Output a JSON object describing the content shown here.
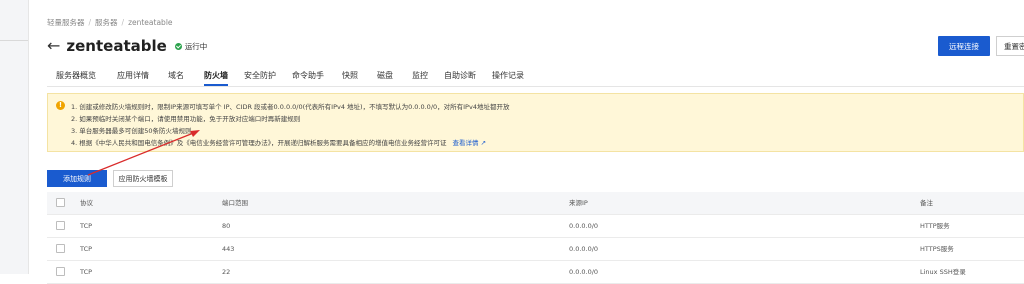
{
  "breadcrumb": {
    "items": [
      "轻量服务器",
      "服务器",
      "zenteatable"
    ]
  },
  "header": {
    "title": "zenteatable",
    "status": "运行中",
    "remote_button": "远程连接",
    "reset_button": "重置密码"
  },
  "tabs": [
    {
      "label": "服务器概览"
    },
    {
      "label": "应用详情"
    },
    {
      "label": "域名"
    },
    {
      "label": "防火墙"
    },
    {
      "label": "安全防护"
    },
    {
      "label": "命令助手"
    },
    {
      "label": "快照"
    },
    {
      "label": "磁盘"
    },
    {
      "label": "监控"
    },
    {
      "label": "自助诊断"
    },
    {
      "label": "操作记录"
    }
  ],
  "active_tab": "防火墙",
  "notice": {
    "lines": [
      "1. 创建或修改防火墙规则时，限制IP来源可填写单个 IP、CIDR 段或者0.0.0.0/0(代表所有IPv4 地址)，不填写默认为0.0.0.0/0，对所有IPv4地址都开放",
      "2. 如果预临时关闭某个端口，请使用禁用功能，免于开放对应端口时再新建规则",
      "3. 单台服务器最多可创建50条防火墙规则",
      "4. 根据《中华人民共和国电信条例》及《电信业务经营许可管理办法》，开展递归解析服务需要具备相应的增值电信业务经营许可证"
    ],
    "link": "查看详情"
  },
  "actions": {
    "add_rule": "添加规则",
    "apply_template": "应用防火墙模板"
  },
  "table": {
    "columns": [
      "协议",
      "端口范围",
      "来源IP",
      "备注"
    ],
    "rows": [
      {
        "protocol": "TCP",
        "port": "80",
        "source": "0.0.0.0/0",
        "remark": "HTTP服务"
      },
      {
        "protocol": "TCP",
        "port": "443",
        "source": "0.0.0.0/0",
        "remark": "HTTPS服务"
      },
      {
        "protocol": "TCP",
        "port": "22",
        "source": "0.0.0.0/0",
        "remark": "Linux SSH登录"
      }
    ]
  },
  "colors": {
    "primary": "#1a5bcf",
    "notice_bg": "#fff7d8",
    "status_green": "#2ba24c",
    "annotation_red": "#d92b2b"
  },
  "icons": {
    "back": "arrow-left-icon",
    "status": "check-circle-icon",
    "warning": "warning-icon",
    "external_link": "external-link-icon"
  }
}
